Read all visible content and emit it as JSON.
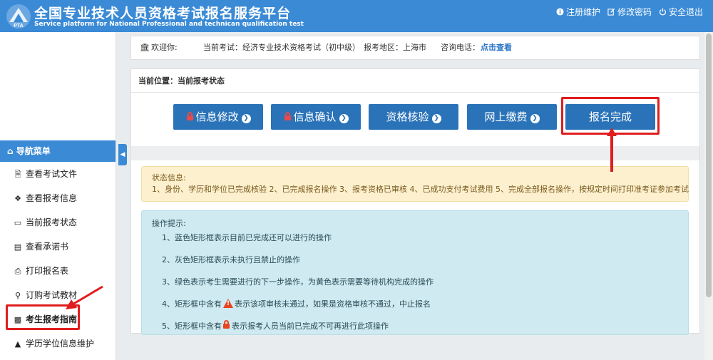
{
  "header": {
    "title": "全国专业技术人员资格考试报名服务平台",
    "subtitle": "Service platform for National Professional and technican qualification test",
    "links": [
      {
        "icon": "info-icon",
        "label": "注册维护"
      },
      {
        "icon": "edit-icon",
        "label": "修改密码"
      },
      {
        "icon": "power-icon",
        "label": "安全退出"
      }
    ]
  },
  "welcome": {
    "greeting": "欢迎你:",
    "exam": "当前考试：经济专业技术资格考试（初中级）",
    "region": "报考地区：上海市",
    "phone_label": "咨询电话：",
    "phone_link": "点击查看"
  },
  "breadcrumb": "当前位置：当前报考状态",
  "steps": [
    {
      "label": "信息修改",
      "locked": true
    },
    {
      "label": "信息确认",
      "locked": true
    },
    {
      "label": "资格核验",
      "locked": false
    },
    {
      "label": "网上缴费",
      "locked": false
    },
    {
      "label": "报名完成",
      "locked": false
    }
  ],
  "status": {
    "title": "状态信息:",
    "text": "1、身份、学历和学位已完成核验 2、已完成报名操作 3、报考资格已审核 4、已成功支付考试费用 5、完成全部报名操作，按规定时间打印准考证参加考试"
  },
  "tips": {
    "title": "操作提示:",
    "t1": "1、蓝色矩形框表示目前已完成还可以进行的操作",
    "t2": "2、灰色矩形框表示未执行且禁止的操作",
    "t3": "3、绿色表示考生需要进行的下一步操作，为黄色表示需要等待机构完成的操作",
    "t4_pre": "4、矩形框中含有",
    "t4_post": "表示该项审核未通过，如果是资格审核不通过，中止报名",
    "t5_pre": "5、矩形框中含有",
    "t5_post": "表示报考人员当前已完成不可再进行此项操作"
  },
  "nav": {
    "header": "导航菜单",
    "items": [
      {
        "icon": "file-icon",
        "label": "查看考试文件"
      },
      {
        "icon": "info-circle-icon",
        "label": "查看报考信息"
      },
      {
        "icon": "monitor-icon",
        "label": "当前报考状态"
      },
      {
        "icon": "id-card-icon",
        "label": "查看承诺书"
      },
      {
        "icon": "print-icon",
        "label": "打印报名表"
      },
      {
        "icon": "cart-icon",
        "label": "订购考试教材"
      },
      {
        "icon": "book-icon",
        "label": "考生报考指南"
      },
      {
        "icon": "graduation-cap-icon",
        "label": "学历学位信息维护"
      }
    ]
  },
  "colors": {
    "header_bg": "#3a8ad6",
    "button_bg": "#2a73b8",
    "highlight_red": "#e01e1e",
    "status_bg": "#fcf0cf",
    "tips_bg": "#cfeaf0"
  }
}
